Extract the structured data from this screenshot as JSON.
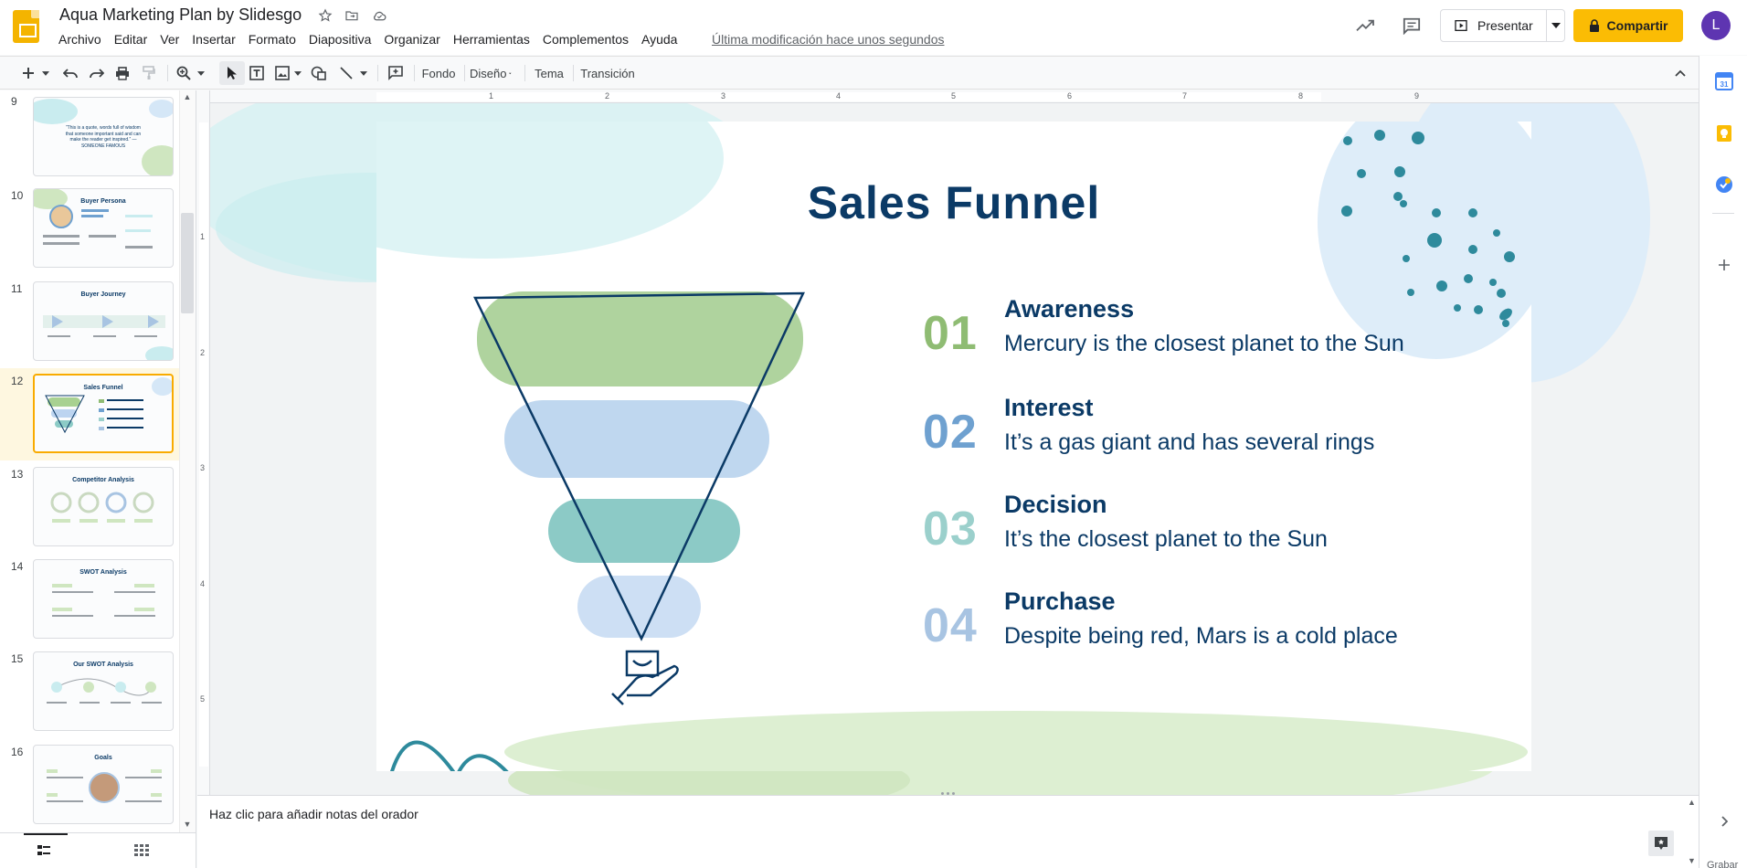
{
  "app": {
    "doc_title": "Aqua Marketing Plan by Slidesgo",
    "menu": [
      "Archivo",
      "Editar",
      "Ver",
      "Insertar",
      "Formato",
      "Diapositiva",
      "Organizar",
      "Herramientas",
      "Complementos",
      "Ayuda"
    ],
    "last_edit": "Última modificación hace unos segundos",
    "present_label": "Presentar",
    "share_label": "Compartir",
    "avatar_letter": "L"
  },
  "toolbar": {
    "background_label": "Fondo",
    "layout_label": "Diseño",
    "theme_label": "Tema",
    "transition_label": "Transición"
  },
  "ruler": {
    "horizontal": [
      "1",
      "2",
      "3",
      "4",
      "5",
      "6",
      "7",
      "8",
      "9"
    ],
    "vertical": [
      "1",
      "2",
      "3",
      "4",
      "5"
    ]
  },
  "filmstrip": {
    "slides": [
      {
        "num": "9",
        "title": "",
        "text": "“This is a quote, words full of wisdom that someone important said and can make the reader get inspired.” —SOMEONE FAMOUS"
      },
      {
        "num": "10",
        "title": "Buyer Persona",
        "text": ""
      },
      {
        "num": "11",
        "title": "Buyer Journey",
        "text": ""
      },
      {
        "num": "12",
        "title": "Sales Funnel",
        "text": ""
      },
      {
        "num": "13",
        "title": "Competitor Analysis",
        "text": ""
      },
      {
        "num": "14",
        "title": "SWOT Analysis",
        "text": ""
      },
      {
        "num": "15",
        "title": "Our SWOT Analysis",
        "text": ""
      },
      {
        "num": "16",
        "title": "Goals",
        "text": ""
      }
    ],
    "active_index": 3
  },
  "slide": {
    "title": "Sales Funnel",
    "steps": [
      {
        "num": "01",
        "heading": "Awareness",
        "desc": "Mercury is the closest planet to the Sun",
        "color": "#8fbc73"
      },
      {
        "num": "02",
        "heading": "Interest",
        "desc": "It’s a gas giant and has several rings",
        "color": "#6fa1d0"
      },
      {
        "num": "03",
        "heading": "Decision",
        "desc": "It’s the closest planet to the Sun",
        "color": "#9bd0cc"
      },
      {
        "num": "04",
        "heading": "Purchase",
        "desc": "Despite being red, Mars is a cold place",
        "color": "#a8c4e2"
      }
    ],
    "funnel_colors": [
      "#94c47e",
      "#a9c9ea",
      "#66b8b3",
      "#bcd4f0"
    ],
    "title_color": "#0b3a66"
  },
  "notes": {
    "placeholder": "Haz clic para añadir notas del orador"
  },
  "side_panel": {
    "record_label": "Grabar"
  }
}
